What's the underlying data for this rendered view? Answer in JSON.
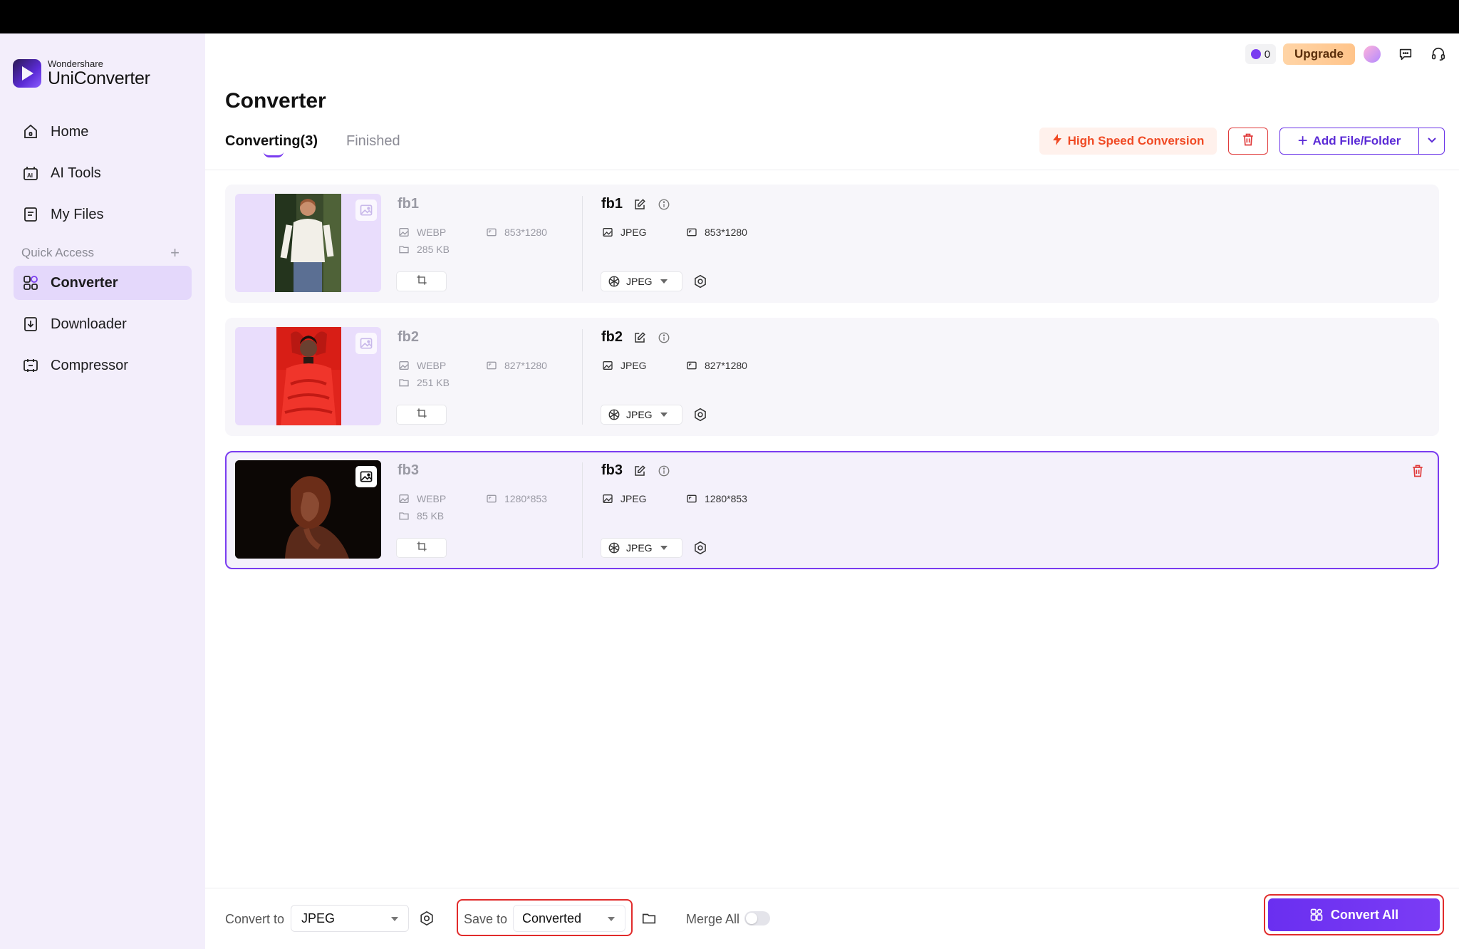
{
  "app": {
    "brand_small": "Wondershare",
    "brand_big": "UniConverter"
  },
  "sidebar": {
    "items": [
      {
        "label": "Home",
        "icon": "home-icon"
      },
      {
        "label": "AI Tools",
        "icon": "ai-tools-icon"
      },
      {
        "label": "My Files",
        "icon": "my-files-icon"
      }
    ],
    "quick_access_label": "Quick Access",
    "quick_items": [
      {
        "label": "Converter",
        "icon": "converter-icon",
        "active": true
      },
      {
        "label": "Downloader",
        "icon": "downloader-icon"
      },
      {
        "label": "Compressor",
        "icon": "compressor-icon"
      }
    ]
  },
  "header": {
    "credits": "0",
    "upgrade_label": "Upgrade"
  },
  "main": {
    "title": "Converter",
    "tabs": [
      {
        "label": "Converting(3)",
        "active": true
      },
      {
        "label": "Finished",
        "active": false
      }
    ],
    "high_speed_label": "High Speed Conversion",
    "add_label": "Add File/Folder"
  },
  "files": [
    {
      "src_name": "fb1",
      "src_format": "WEBP",
      "src_size": "285 KB",
      "src_dims": "853*1280",
      "out_name": "fb1",
      "out_format": "JPEG",
      "out_dims": "853*1280",
      "target_format": "JPEG"
    },
    {
      "src_name": "fb2",
      "src_format": "WEBP",
      "src_size": "251 KB",
      "src_dims": "827*1280",
      "out_name": "fb2",
      "out_format": "JPEG",
      "out_dims": "827*1280",
      "target_format": "JPEG"
    },
    {
      "src_name": "fb3",
      "src_format": "WEBP",
      "src_size": "85 KB",
      "src_dims": "1280*853",
      "out_name": "fb3",
      "out_format": "JPEG",
      "out_dims": "1280*853",
      "target_format": "JPEG"
    }
  ],
  "bottom": {
    "convert_to_label": "Convert to",
    "convert_to_value": "JPEG",
    "save_to_label": "Save to",
    "save_to_value": "Converted",
    "merge_label": "Merge All",
    "convert_all_label": "Convert All"
  },
  "colors": {
    "accent": "#7a3cf0",
    "danger": "#e12b2b",
    "high_speed": "#f04a24",
    "sidebar_bg": "#f3eefb"
  }
}
